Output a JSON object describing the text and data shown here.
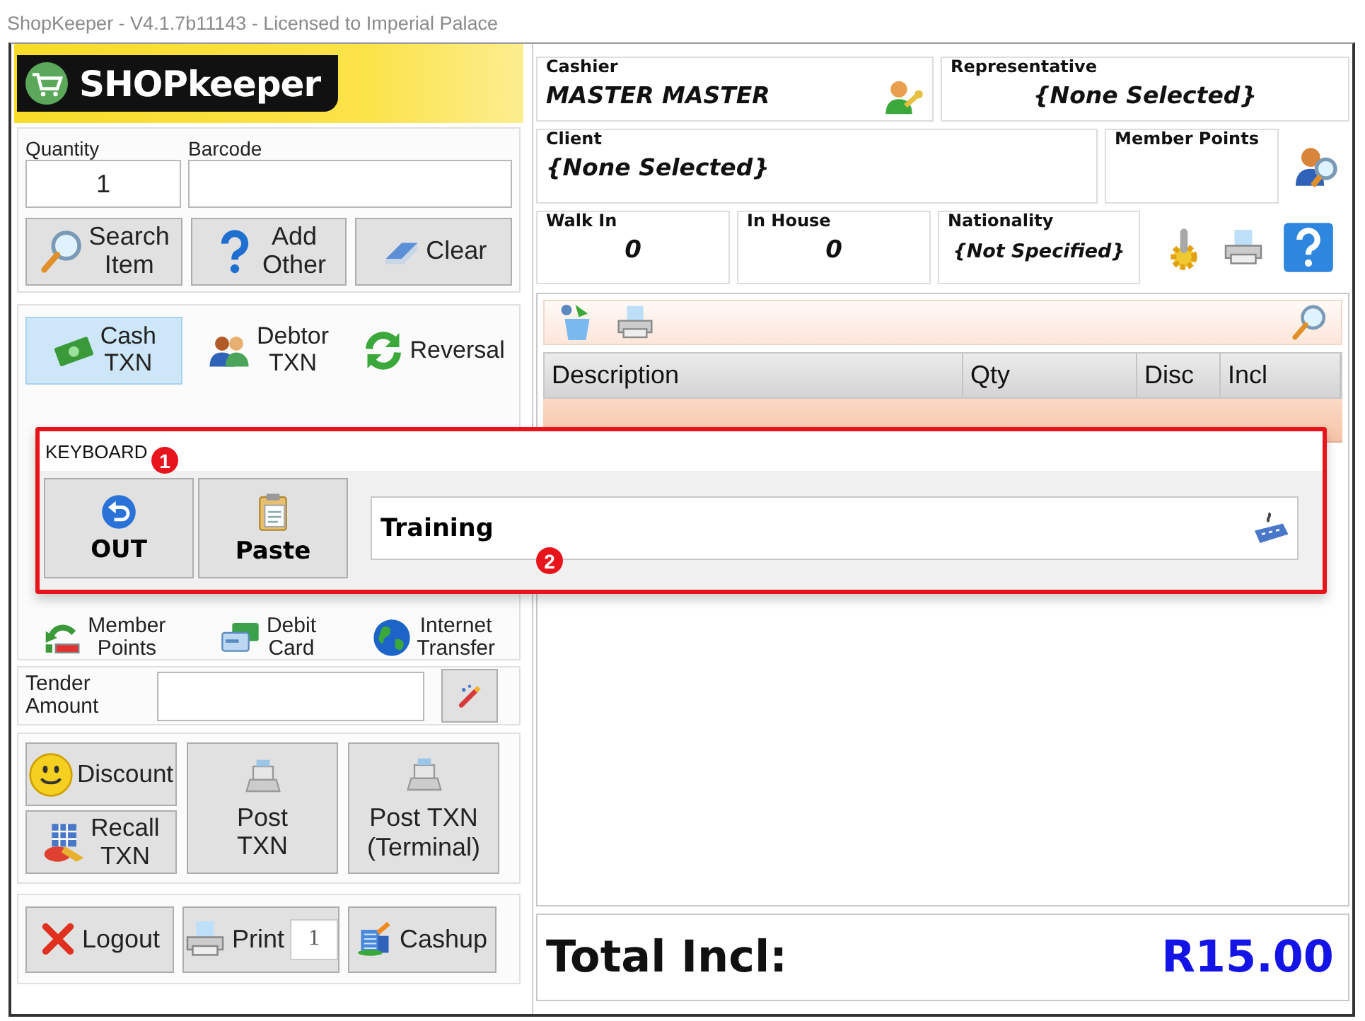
{
  "window": {
    "title": "ShopKeeper - V4.1.7b11143 - Licensed to Imperial Palace"
  },
  "logo": {
    "text": "SHOPkeeper"
  },
  "item_entry": {
    "quantity": {
      "label": "Quantity",
      "value": "1"
    },
    "barcode": {
      "label": "Barcode"
    },
    "buttons": [
      {
        "label": "Search Item"
      },
      {
        "label": "Add Other"
      },
      {
        "label": "Clear"
      }
    ]
  },
  "payment_methods": [
    {
      "label": "Cash TXN",
      "selected": true
    },
    {
      "label": "Debtor TXN",
      "selected": false
    },
    {
      "label": "Reversal",
      "selected": false
    },
    {
      "label": "Member Points",
      "selected": false
    },
    {
      "label": "Debit Card",
      "selected": false
    },
    {
      "label": "Internet Transfer",
      "selected": false
    }
  ],
  "tender": {
    "label": "Tender Amount"
  },
  "actions": [
    {
      "label": "Discount"
    },
    {
      "label": "Recall TXN"
    },
    {
      "label": "Post TXN"
    },
    {
      "label": "Post TXN (Terminal)"
    }
  ],
  "footer_buttons": [
    {
      "label": "Logout"
    },
    {
      "label": "Print",
      "copies": "1"
    },
    {
      "label": "Cashup"
    }
  ],
  "transaction_info": {
    "cashier": {
      "label": "Cashier",
      "value": "MASTER MASTER"
    },
    "representative": {
      "label": "Representative",
      "value": "{None Selected}"
    },
    "client": {
      "label": "Client",
      "value": "{None Selected}"
    },
    "member_points": {
      "label": "Member Points"
    },
    "walk_in": {
      "label": "Walk In",
      "value": "0"
    },
    "in_house": {
      "label": "In House",
      "value": "0"
    },
    "nationality": {
      "label": "Nationality",
      "value": "{Not Specified}"
    }
  },
  "items_table": {
    "columns": [
      "Description",
      "Qty",
      "Disc",
      "Incl"
    ]
  },
  "total": {
    "label": "Total Incl:",
    "value": "R15.00"
  },
  "keyboard_panel": {
    "title": "KEYBOARD",
    "buttons": [
      {
        "label": "OUT"
      },
      {
        "label": "Paste"
      }
    ],
    "input": {
      "value": "Training"
    }
  },
  "callouts": [
    {
      "number": "1"
    },
    {
      "number": "2"
    }
  ]
}
